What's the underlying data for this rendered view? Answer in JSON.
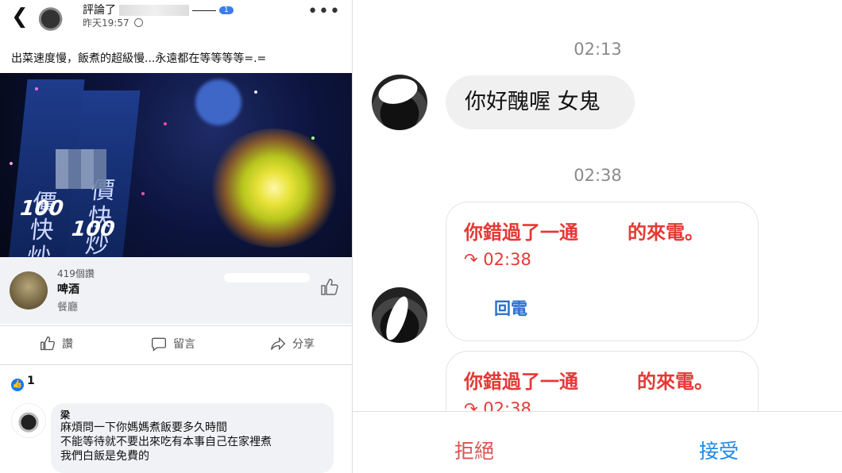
{
  "post": {
    "header_title_prefix": "評論了",
    "header_badge": "1",
    "time": "昨天19:57",
    "text": "出菜速度慢，飯煮的超級慢...永遠都在等等等等=.=",
    "sign_text_1": "價快炒",
    "sign_text_2": "價快炒",
    "sign_num_1": "100",
    "sign_num_2": "100"
  },
  "page_card": {
    "likes": "419個讚",
    "name": "啤酒",
    "category": "餐廳"
  },
  "actions": {
    "like": "讚",
    "comment": "留言",
    "share": "分享"
  },
  "reactions": {
    "count": "1"
  },
  "comment": {
    "author": "梁",
    "lines": [
      "麻煩問一下你媽媽煮飯要多久時間",
      "不能等待就不要出來吃有本事自己在家裡煮",
      "我們白飯是免費的"
    ]
  },
  "messenger": {
    "timestamp_1": "02:13",
    "message_1": "你好醜喔 女鬼",
    "timestamp_2": "02:38",
    "missed_call_prefix": "你錯過了一通",
    "missed_call_suffix": "的來電。",
    "call_time": "02:38",
    "call_back": "回電",
    "decline": "拒絕",
    "accept": "接受"
  },
  "colors": {
    "missed_call_red": "#e53935",
    "link_blue": "#2a6fcf",
    "accept_blue": "#1e88e5",
    "decline_red": "#d9534f",
    "fb_blue": "#1877f2"
  }
}
